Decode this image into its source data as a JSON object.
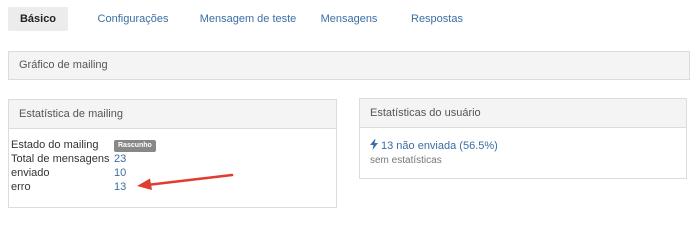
{
  "tabs": [
    {
      "label": "Básico",
      "active": true
    },
    {
      "label": "Configurações",
      "active": false
    },
    {
      "label": "Mensagem de teste",
      "active": false
    },
    {
      "label": "Mensagens",
      "active": false
    },
    {
      "label": "Respostas",
      "active": false
    }
  ],
  "chart_panel": {
    "title": "Gráfico de mailing"
  },
  "mailing_stats": {
    "title": "Estatística de mailing",
    "rows": [
      {
        "label": "Estado do mailing",
        "value": "Rascunho"
      },
      {
        "label": "Total de mensagens",
        "value": "23"
      },
      {
        "label": "enviado",
        "value": "10"
      },
      {
        "label": "erro",
        "value": "13"
      }
    ]
  },
  "user_stats": {
    "title": "Estatísticas do usuário",
    "not_sent": "13 não enviada (56.5%)",
    "no_stats": "sem estatísticas"
  },
  "colors": {
    "link": "#3b6ea5",
    "arrow": "#e03c31",
    "badge": "#888888"
  }
}
